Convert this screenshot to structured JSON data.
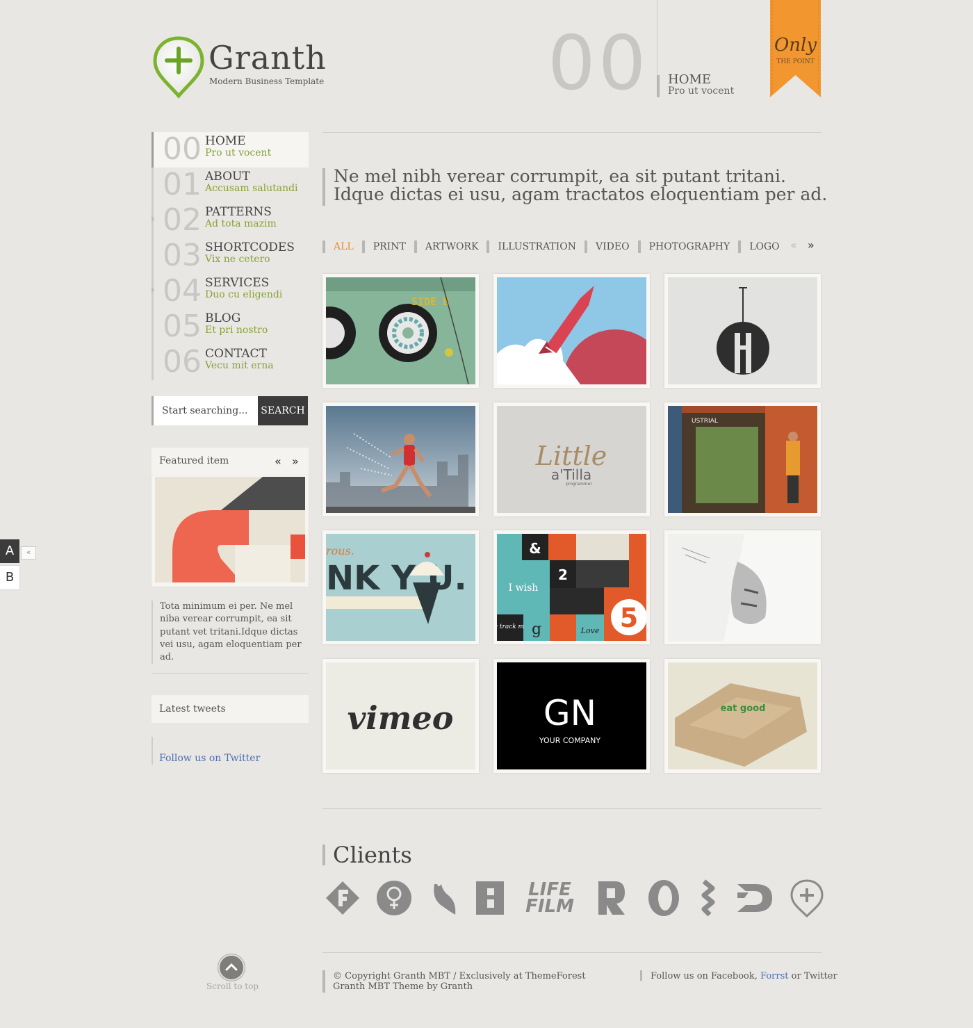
{
  "brand": {
    "name": "Granth",
    "tagline": "Modern Business Template",
    "accent": "#7bb32e"
  },
  "header": {
    "number": "00",
    "title": "HOME",
    "subtitle": "Pro ut vocent"
  },
  "ribbon": {
    "big": "Only",
    "small": "THE POINT",
    "color": "#f2962f"
  },
  "nav": [
    {
      "num": "00",
      "title": "HOME",
      "sub": "Pro ut vocent"
    },
    {
      "num": "01",
      "title": "ABOUT",
      "sub": "Accusam salutandi"
    },
    {
      "num": "02",
      "title": "PATTERNS",
      "sub": "Ad tota mazim"
    },
    {
      "num": "03",
      "title": "SHORTCODES",
      "sub": "Vix ne cetero"
    },
    {
      "num": "04",
      "title": "SERVICES",
      "sub": "Duo cu eligendi"
    },
    {
      "num": "05",
      "title": "BLOG",
      "sub": "Et pri nostro"
    },
    {
      "num": "06",
      "title": "CONTACT",
      "sub": "Vecu mit erna"
    }
  ],
  "search": {
    "placeholder": "Start searching...",
    "button": "SEARCH"
  },
  "featured": {
    "label": "Featured item",
    "prev": "«",
    "next": "»",
    "text": "Tota minimum ei per. Ne mel niba verear corrumpit, ea sit putant vet tritani.Idque dictas vei usu, agam eloquentiam per ad."
  },
  "tweets": {
    "label": "Latest tweets",
    "follow": "Follow us on Twitter"
  },
  "scroll": {
    "label": "Scroll to top"
  },
  "switcher": {
    "a": "A",
    "b": "B",
    "toggle": "«"
  },
  "intro": {
    "line1": "Ne mel nibh verear corrumpit, ea sit putant tritani.",
    "line2": "Idque dictas ei usu, agam tractatos eloquentiam per ad."
  },
  "filters": [
    "ALL",
    "PRINT",
    "ARTWORK",
    "ILLUSTRATION",
    "VIDEO",
    "PHOTOGRAPHY",
    "LOGO"
  ],
  "filter_nav": {
    "prev": "«",
    "next": "»"
  },
  "portfolio": {
    "cassette_label": "SIDE B",
    "little": "Little",
    "attilla": "a'Tilla",
    "programmer": "programmer",
    "store_sign": "USTRIAL",
    "thanks": "NK Y   U.",
    "thanks_top": "rous.",
    "iwish": "I wish",
    "amp": "&",
    "two": "2",
    "five": "5",
    "love": "Love",
    "g": "g",
    "onetrack": "one track mind",
    "vimeo": "vimeo",
    "gn": "GN",
    "your_company": "YOUR COMPANY",
    "boxes_text": "eat good"
  },
  "clients": {
    "title": "Clients",
    "logos": [
      "F",
      "♀",
      "ɕ",
      "B",
      "LIFE FILM",
      "R",
      "O",
      "ʒ",
      "3D",
      "+"
    ]
  },
  "footer": {
    "line1": "© Copyright Granth MBT / Exclusively at ThemeForest",
    "line2": "Granth MBT Theme by Granth",
    "right_prefix": "Follow us on Facebook,",
    "right_link": "Forrst",
    "right_suffix": "or Twitter"
  }
}
